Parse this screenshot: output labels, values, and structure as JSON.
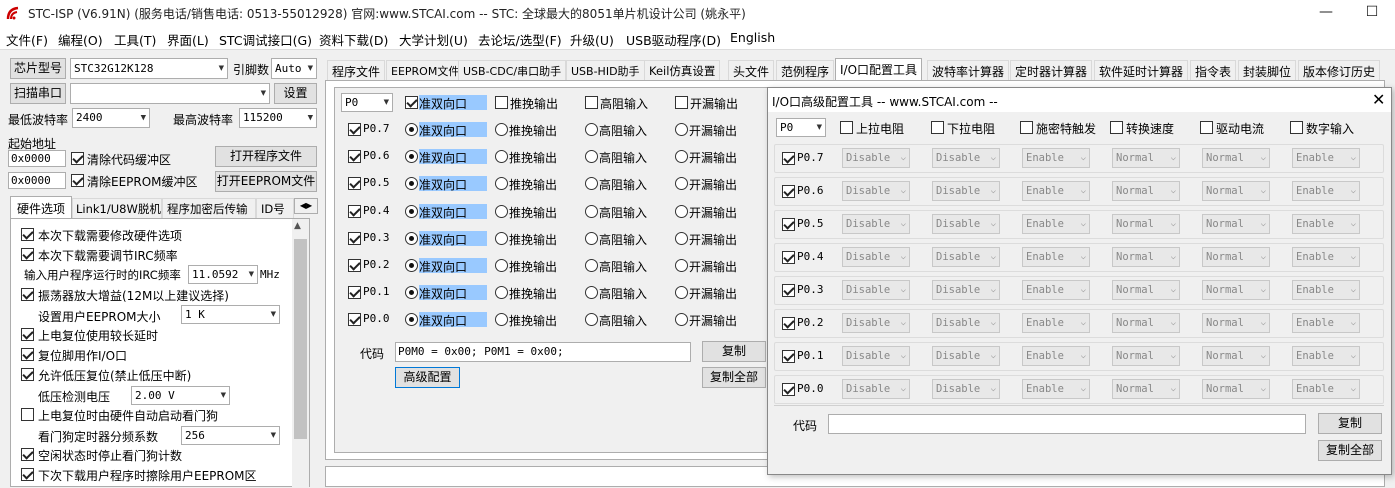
{
  "window": {
    "title": "STC-ISP (V6.91N) (服务电话/销售电话: 0513-55012928) 官网:www.STCAI.com  -- STC: 全球最大的8051单片机设计公司 (姚永平)"
  },
  "menu": [
    "文件(F)",
    "编程(O)",
    "工具(T)",
    "界面(L)",
    "STC调试接口(G)",
    "资料下载(D)",
    "大学计划(U)",
    "去论坛/选型(F)",
    "升级(U)",
    "USB驱动程序(D)",
    "English"
  ],
  "left": {
    "chip_btn": "芯片型号",
    "chip_value": "STC32G12K128",
    "pins_label": "引脚数",
    "pins_value": "Auto",
    "scan_btn": "扫描串口",
    "port_value": "",
    "settings_btn": "设置",
    "min_baud_label": "最低波特率",
    "min_baud": "2400",
    "max_baud_label": "最高波特率",
    "max_baud": "115200",
    "start_addr_label": "起始地址",
    "addr1": "0x0000",
    "clear_code": "清除代码缓冲区",
    "open_prog": "打开程序文件",
    "addr2": "0x0000",
    "clear_eeprom": "清除EEPROM缓冲区",
    "open_eeprom": "打开EEPROM文件",
    "tabs": [
      "硬件选项",
      "Link1/U8W脱机",
      "程序加密后传输",
      "ID号"
    ],
    "options": [
      {
        "label": "本次下载需要修改硬件选项",
        "checked": true
      },
      {
        "label": "本次下载需要调节IRC频率",
        "checked": true
      },
      {
        "label": "输入用户程序运行时的IRC频率",
        "value": "11.0592",
        "unit": "MHz"
      },
      {
        "label": "振荡器放大增益(12M以上建议选择)",
        "checked": true
      },
      {
        "label": "设置用户EEPROM大小",
        "value": "1   K"
      },
      {
        "label": "上电复位使用较长延时",
        "checked": true
      },
      {
        "label": "复位脚用作I/O口",
        "checked": true
      },
      {
        "label": "允许低压复位(禁止低压中断)",
        "checked": true
      },
      {
        "label": "低压检测电压",
        "value": "2.00 V"
      },
      {
        "label": "上电复位时由硬件自动启动看门狗",
        "checked": false
      },
      {
        "label": "看门狗定时器分频系数",
        "value": "256"
      },
      {
        "label": "空闲状态时停止看门狗计数",
        "checked": true
      },
      {
        "label": "下次下载用户程序时擦除用户EEPROM区",
        "checked": true
      }
    ]
  },
  "main_tabs": [
    "程序文件",
    "EEPROM文件",
    "USB-CDC/串口助手",
    "USB-HID助手",
    "Keil仿真设置",
    "头文件",
    "范例程序",
    "I/O口配置工具",
    "波特率计算器",
    "定时器计算器",
    "软件延时计算器",
    "指令表",
    "封装脚位",
    "版本修订历史"
  ],
  "io": {
    "port": "P0",
    "modes": [
      "准双向口",
      "推挽输出",
      "高阻输入",
      "开漏输出"
    ],
    "pins": [
      "P0.7",
      "P0.6",
      "P0.5",
      "P0.4",
      "P0.3",
      "P0.2",
      "P0.1",
      "P0.0"
    ],
    "code_label": "代码",
    "code_value": "P0M0 = 0x00; P0M1 = 0x00;",
    "copy_btn": "复制",
    "advanced_btn": "高级配置",
    "copy_all_btn": "复制全部"
  },
  "adv": {
    "title": "I/O口高级配置工具 -- www.STCAI.com --",
    "port": "P0",
    "headers": [
      "上拉电阻",
      "下拉电阻",
      "施密特触发",
      "转换速度",
      "驱动电流",
      "数字输入"
    ],
    "values": [
      "Disable",
      "Disable",
      "Enable",
      "Normal",
      "Normal",
      "Enable"
    ],
    "code_label": "代码",
    "code_value": "",
    "copy_btn": "复制",
    "copy_all_btn": "复制全部"
  }
}
